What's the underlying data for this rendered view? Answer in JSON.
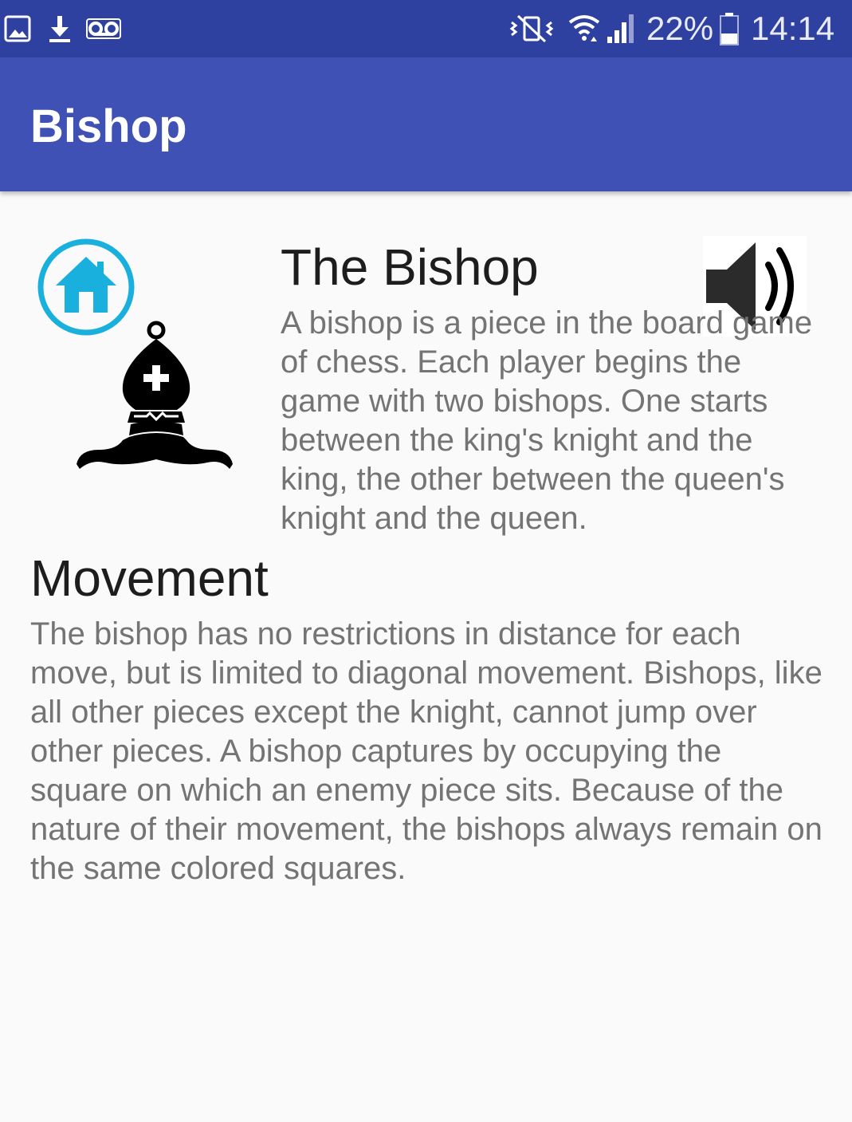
{
  "status_bar": {
    "left_icons": [
      "gallery-icon",
      "download-icon",
      "voicemail-icon"
    ],
    "right_icons": [
      "vibrate-mute-icon",
      "wifi-icon",
      "signal-icon",
      "battery-icon"
    ],
    "battery": "22%",
    "time": "14:14"
  },
  "app_bar": {
    "title": "Bishop",
    "color": "#3f51b5",
    "status_color": "#2f41a0"
  },
  "intro": {
    "title": "The Bishop",
    "text": "A bishop is a piece in the board game of chess. Each player begins the game with two bishops. One starts between the king's knight and the king, the other between the queen's knight and the queen."
  },
  "movement": {
    "title": "Movement",
    "text": "The bishop has no restrictions in distance for each move, but is limited to diagonal movement. Bishops, like all other pieces except the knight, cannot jump over other pieces. A bishop captures by occupying the square on which an enemy piece sits. Because of the nature of their movement, the bishops always remain on the same colored squares."
  },
  "icons": {
    "home": "home-icon",
    "piece": "bishop-icon",
    "audio": "speaker-icon",
    "accent": "#1ab0de"
  }
}
